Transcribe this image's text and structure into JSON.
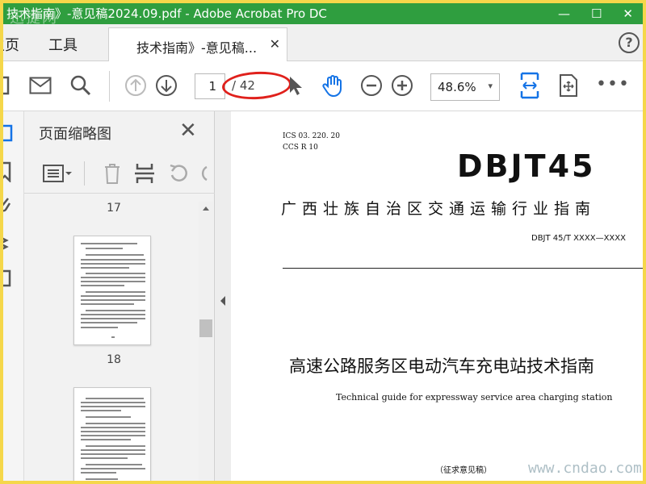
{
  "window": {
    "title": "技术指南》-意见稿2024.09.pdf - Adobe Acrobat Pro DC",
    "watermark": "迅捷网",
    "controls": [
      "—",
      "☐",
      "✕"
    ]
  },
  "tabs": {
    "home": "主页",
    "tools": "工具",
    "document": "技术指南》-意见稿...",
    "close": "✕",
    "help": "?"
  },
  "toolbar": {
    "current_page": "1",
    "total_pages": "/ 42",
    "zoom": "48.6%",
    "zoom_caret": "▾",
    "more": "•••"
  },
  "thumbnail_panel": {
    "title": "页面缩略图",
    "close": "✕",
    "pages": [
      "17",
      "18"
    ]
  },
  "document": {
    "ics": "ICS  03. 220. 20",
    "ccs": "CCS  R 10",
    "logo": "DBJT45",
    "industry": "广西壮族自治区交通运输行业指南",
    "code": "DBJT 45/T  XXXX—XXXX",
    "title": "高速公路服务区电动汽车充电站技术指南",
    "subtitle": "Technical guide for expressway service area charging station",
    "draft": "（征求意见稿）"
  },
  "site_watermark": "www.cndao.com",
  "colors": {
    "titlebar": "#2f9e3f",
    "accent_blue": "#1473e6",
    "annotation_red": "#e0211c",
    "outer_border": "#f5d74a"
  }
}
